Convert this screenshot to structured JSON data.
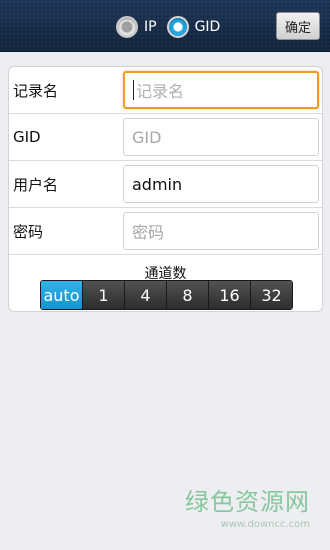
{
  "header": {
    "modes": [
      {
        "label": "IP",
        "selected": false
      },
      {
        "label": "GID",
        "selected": true
      }
    ],
    "confirm_label": "确定"
  },
  "form": {
    "rows": [
      {
        "label": "记录名",
        "value": "",
        "placeholder": "记录名",
        "focused": true
      },
      {
        "label": "GID",
        "value": "",
        "placeholder": "GID",
        "focused": false
      },
      {
        "label": "用户名",
        "value": "admin",
        "placeholder": "",
        "focused": false
      },
      {
        "label": "密码",
        "value": "",
        "placeholder": "密码",
        "focused": false
      }
    ],
    "channels": {
      "title": "通道数",
      "options": [
        "auto",
        "1",
        "4",
        "8",
        "16",
        "32"
      ],
      "selected": "auto"
    }
  },
  "watermark": {
    "text": "绿色资源网",
    "url": "www.downcc.com"
  },
  "colors": {
    "accent": "#1fa6e0",
    "focus": "#f39b2a",
    "header_bg": "#1d3557"
  }
}
